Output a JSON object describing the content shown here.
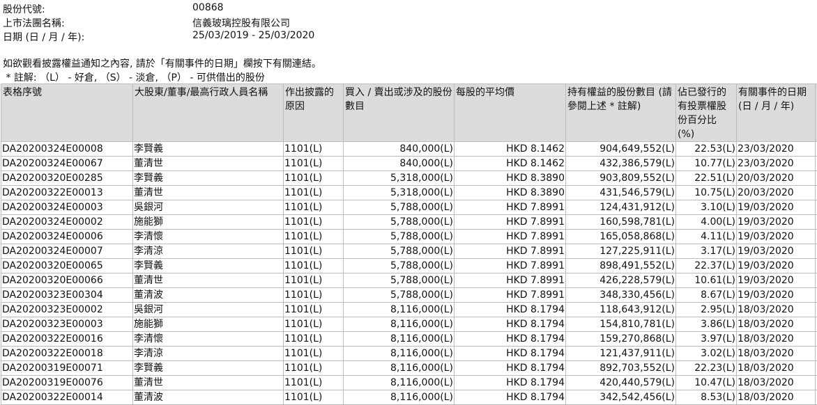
{
  "header": {
    "stock_code_label": "股份代號:",
    "stock_code": "00868",
    "company_label": "上市法團名稱:",
    "company": "信義玻璃控股有限公司",
    "date_label": "日期 (日 / 月 / 年):",
    "date_range": "25/03/2019 - 25/03/2020"
  },
  "notes": {
    "line1": "如欲觀看披露權益通知之內容, 請於「有關事件的日期」欄按下有關連結。",
    "line2": " * 註解: （L） - 好倉, （S） - 淡倉, （P） - 可供借出的股份"
  },
  "table": {
    "headers": [
      "表格序號",
      "大股東/董事/最高行政人員名稱",
      "作出披露的原因",
      "買入 / 賣出或涉及的股份數目",
      "每股的平均價",
      "持有權益的股份數目 (請參閱上述 * 註解)",
      "佔已發行的有投票權股份百分比 (%)",
      "有關事件的日期 (日 / 月 / 年)"
    ],
    "rows": [
      [
        "DA20200324E00008",
        "李賢義",
        "1101(L)",
        "840,000(L)",
        "HKD 8.1462",
        "904,649,552(L)",
        "22.53(L)",
        "23/03/2020"
      ],
      [
        "DA20200324E00067",
        "董清世",
        "1101(L)",
        "840,000(L)",
        "HKD 8.1462",
        "432,386,579(L)",
        "10.77(L)",
        "23/03/2020"
      ],
      [
        "DA20200320E00285",
        "李賢義",
        "1101(L)",
        "5,318,000(L)",
        "HKD 8.3890",
        "903,809,552(L)",
        "22.51(L)",
        "20/03/2020"
      ],
      [
        "DA20200322E00013",
        "董清世",
        "1101(L)",
        "5,318,000(L)",
        "HKD 8.3890",
        "431,546,579(L)",
        "10.75(L)",
        "20/03/2020"
      ],
      [
        "DA20200324E00003",
        "吳銀河",
        "1101(L)",
        "5,788,000(L)",
        "HKD 7.8991",
        "124,431,912(L)",
        "3.10(L)",
        "19/03/2020"
      ],
      [
        "DA20200324E00002",
        "施能獅",
        "1101(L)",
        "5,788,000(L)",
        "HKD 7.8991",
        "160,598,781(L)",
        "4.00(L)",
        "19/03/2020"
      ],
      [
        "DA20200324E00006",
        "李清懷",
        "1101(L)",
        "5,788,000(L)",
        "HKD 7.8991",
        "165,058,868(L)",
        "4.11(L)",
        "19/03/2020"
      ],
      [
        "DA20200324E00007",
        "李清涼",
        "1101(L)",
        "5,788,000(L)",
        "HKD 7.8991",
        "127,225,911(L)",
        "3.17(L)",
        "19/03/2020"
      ],
      [
        "DA20200320E00065",
        "李賢義",
        "1101(L)",
        "5,788,000(L)",
        "HKD 7.8991",
        "898,491,552(L)",
        "22.37(L)",
        "19/03/2020"
      ],
      [
        "DA20200320E00066",
        "董清世",
        "1101(L)",
        "5,788,000(L)",
        "HKD 7.8991",
        "426,228,579(L)",
        "10.61(L)",
        "19/03/2020"
      ],
      [
        "DA20200323E00304",
        "董清波",
        "1101(L)",
        "5,788,000(L)",
        "HKD 7.8991",
        "348,330,456(L)",
        "8.67(L)",
        "19/03/2020"
      ],
      [
        "DA20200323E00002",
        "吳銀河",
        "1101(L)",
        "8,116,000(L)",
        "HKD 8.1794",
        "118,643,912(L)",
        "2.95(L)",
        "18/03/2020"
      ],
      [
        "DA20200323E00003",
        "施能獅",
        "1101(L)",
        "8,116,000(L)",
        "HKD 8.1794",
        "154,810,781(L)",
        "3.86(L)",
        "18/03/2020"
      ],
      [
        "DA20200322E00016",
        "李清懷",
        "1101(L)",
        "8,116,000(L)",
        "HKD 8.1794",
        "159,270,868(L)",
        "3.97(L)",
        "18/03/2020"
      ],
      [
        "DA20200322E00018",
        "李清涼",
        "1101(L)",
        "8,116,000(L)",
        "HKD 8.1794",
        "121,437,911(L)",
        "3.02(L)",
        "18/03/2020"
      ],
      [
        "DA20200319E00071",
        "李賢義",
        "1101(L)",
        "8,116,000(L)",
        "HKD 8.1794",
        "892,703,552(L)",
        "22.23(L)",
        "18/03/2020"
      ],
      [
        "DA20200319E00076",
        "董清世",
        "1101(L)",
        "8,116,000(L)",
        "HKD 8.1794",
        "420,440,579(L)",
        "10.47(L)",
        "18/03/2020"
      ],
      [
        "DA20200322E00014",
        "董清波",
        "1101(L)",
        "8,116,000(L)",
        "HKD 8.1794",
        "342,542,456(L)",
        "8.53(L)",
        "18/03/2020"
      ]
    ]
  }
}
